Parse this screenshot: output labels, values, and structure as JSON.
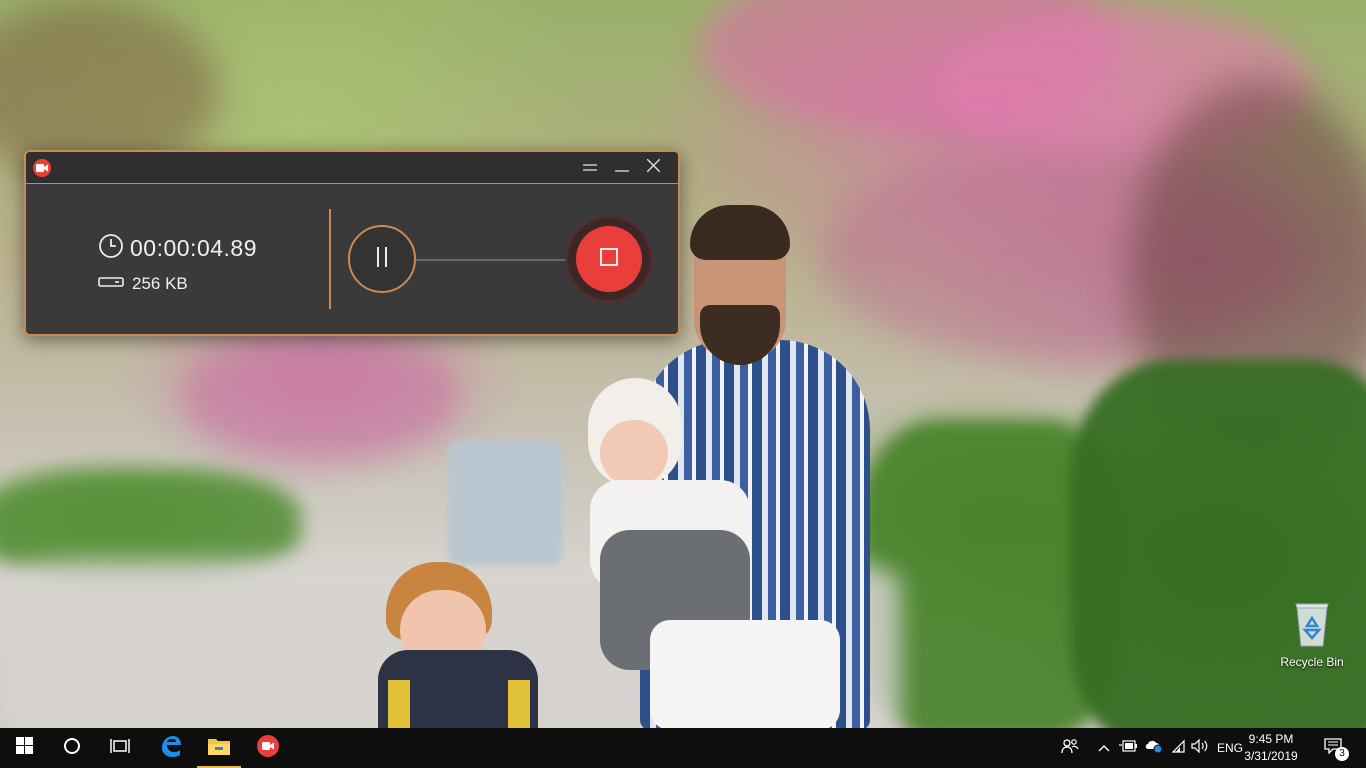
{
  "recorder": {
    "elapsed_time": "00:00:04.89",
    "file_size": "256 KB",
    "accent_color": "#c98a55",
    "record_color": "#ea3e3b"
  },
  "desktop": {
    "recycle_bin_label": "Recycle Bin"
  },
  "taskbar": {
    "pinned": [
      "windows-start",
      "cortana-search",
      "task-view",
      "edge",
      "file-explorer",
      "screen-recorder"
    ],
    "language": "ENG",
    "time": "9:45 PM",
    "date": "3/31/2019",
    "notification_count": "3"
  }
}
